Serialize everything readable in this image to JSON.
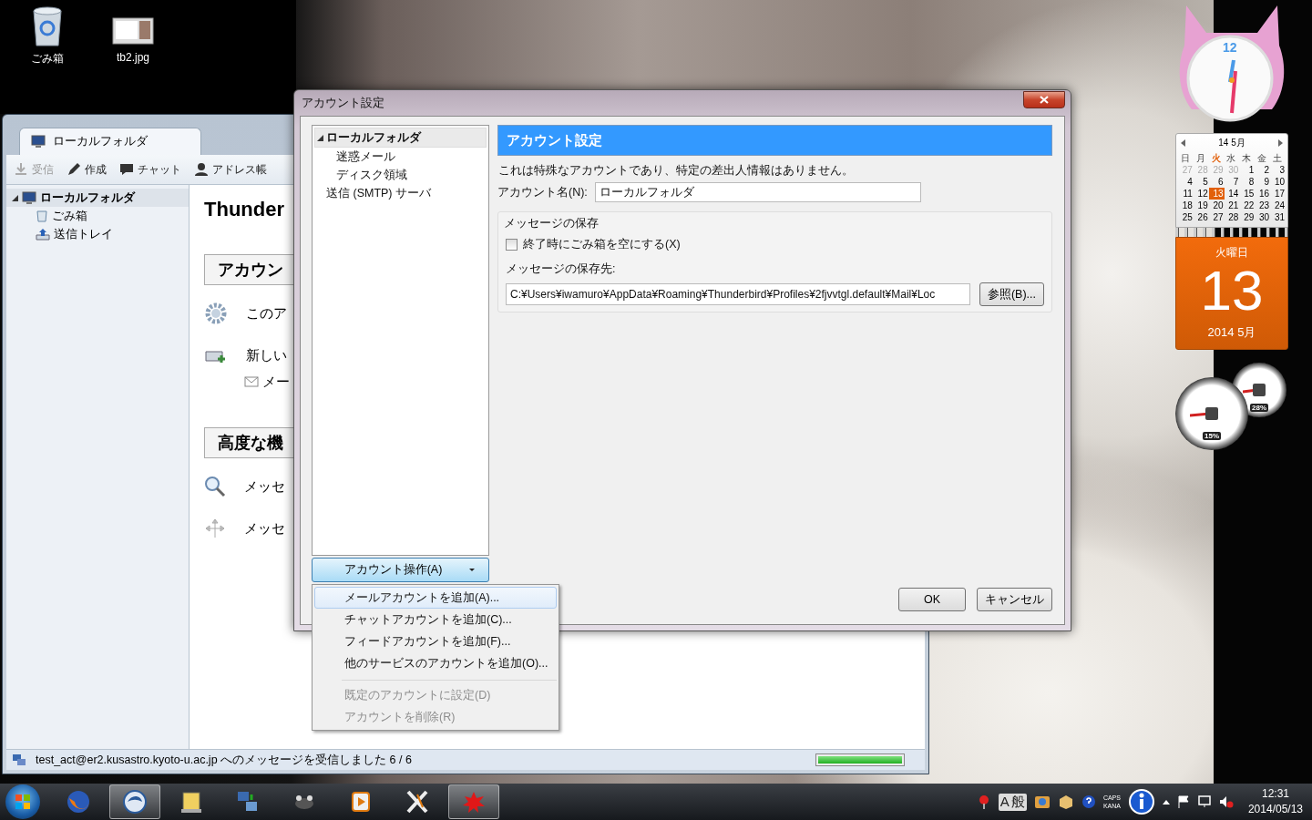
{
  "desktop_icons": [
    {
      "label": "ごみ箱",
      "kind": "trash"
    },
    {
      "label": "tb2.jpg",
      "kind": "image"
    }
  ],
  "mail_window": {
    "tab": "ローカルフォルダ",
    "toolbar": [
      {
        "label": "受信",
        "kind": "get",
        "disabled": true
      },
      {
        "label": "作成",
        "kind": "write",
        "disabled": false
      },
      {
        "label": "チャット",
        "kind": "chat",
        "disabled": false
      },
      {
        "label": "アドレス帳",
        "kind": "contacts",
        "disabled": false
      }
    ],
    "folders": [
      {
        "label": "ローカルフォルダ",
        "kind": "local",
        "selected": true,
        "expanded": true,
        "children": [
          {
            "label": "ごみ箱",
            "kind": "trash",
            "selected": false
          },
          {
            "label": "送信トレイ",
            "kind": "outbox",
            "selected": false
          }
        ]
      }
    ],
    "content": {
      "title": "Thunder",
      "sections": [
        {
          "heading": "アカウン",
          "items": [
            {
              "text": "このア",
              "kind": "gear"
            },
            {
              "text": "新しい",
              "kind": "new-account"
            },
            {
              "text": "メー",
              "kind": "mail"
            }
          ]
        },
        {
          "heading": "高度な機",
          "items": [
            {
              "text": "メッセ",
              "kind": "search"
            },
            {
              "text": "メッセ",
              "kind": "filter"
            }
          ]
        }
      ]
    },
    "status_bar": {
      "text": "test_act@er2.kusastro.kyoto-u.ac.jp へのメッセージを受信しました 6 / 6",
      "level": 1
    }
  },
  "dialog": {
    "title": "アカウント設定",
    "tree": [
      {
        "label": "ローカルフォルダ",
        "expanded": true,
        "selected": true,
        "children": [
          {
            "label": "迷惑メール",
            "selected": false
          },
          {
            "label": "ディスク領域",
            "selected": false
          }
        ]
      },
      {
        "label": "送信 (SMTP) サーバ",
        "selected": false
      }
    ],
    "heading": "アカウント設定",
    "note": "これは特殊なアカウントであり、特定の差出人情報はありません。",
    "account_name": {
      "label": "アカウント名(N):",
      "value": "ローカルフォルダ"
    },
    "storage": {
      "legend": "メッセージの保存",
      "empty_trash": {
        "label": "終了時にごみ箱を空にする(X)",
        "checked": false
      },
      "path_label": "メッセージの保存先:",
      "path": "C:¥Users¥iwamuro¥AppData¥Roaming¥Thunderbird¥Profiles¥2fjvvtgl.default¥Mail¥Loc",
      "browse": "参照(B)..."
    },
    "account_actions": {
      "label": "アカウント操作(A)",
      "expanded": true
    },
    "menu": [
      [
        {
          "label": "メールアカウントを追加(A)...",
          "selected": true,
          "disabled": false
        },
        {
          "label": "チャットアカウントを追加(C)...",
          "selected": false,
          "disabled": false
        },
        {
          "label": "フィードアカウントを追加(F)...",
          "selected": false,
          "disabled": false
        },
        {
          "label": "他のサービスのアカウントを追加(O)...",
          "selected": false,
          "disabled": false
        }
      ],
      [
        {
          "label": "既定のアカウントに設定(D)",
          "selected": false,
          "disabled": true
        },
        {
          "label": "アカウントを削除(R)",
          "selected": false,
          "disabled": true
        }
      ]
    ],
    "buttons": [
      "OK",
      "キャンセル"
    ]
  },
  "gadgets": {
    "clock": {
      "numeral": "12"
    },
    "calendar": {
      "month": "14 5月",
      "weekdays": [
        {
          "label": "日",
          "selected": false
        },
        {
          "label": "月",
          "selected": false
        },
        {
          "label": "火",
          "selected": true
        },
        {
          "label": "水",
          "selected": false
        },
        {
          "label": "木",
          "selected": false
        },
        {
          "label": "金",
          "selected": false
        },
        {
          "label": "土",
          "selected": false
        }
      ],
      "weeks": [
        [
          {
            "day": "27",
            "muted": true,
            "selected": false
          },
          {
            "day": "28",
            "muted": true,
            "selected": false
          },
          {
            "day": "29",
            "muted": true,
            "selected": false
          },
          {
            "day": "30",
            "muted": true,
            "selected": false
          },
          {
            "day": "1",
            "muted": false,
            "selected": false
          },
          {
            "day": "2",
            "muted": false,
            "selected": false
          },
          {
            "day": "3",
            "muted": false,
            "selected": false
          }
        ],
        [
          {
            "day": "4",
            "muted": false,
            "selected": false
          },
          {
            "day": "5",
            "muted": false,
            "selected": false
          },
          {
            "day": "6",
            "muted": false,
            "selected": false
          },
          {
            "day": "7",
            "muted": false,
            "selected": false
          },
          {
            "day": "8",
            "muted": false,
            "selected": false
          },
          {
            "day": "9",
            "muted": false,
            "selected": false
          },
          {
            "day": "10",
            "muted": false,
            "selected": false
          }
        ],
        [
          {
            "day": "11",
            "muted": false,
            "selected": false
          },
          {
            "day": "12",
            "muted": false,
            "selected": false
          },
          {
            "day": "13",
            "muted": false,
            "selected": true
          },
          {
            "day": "14",
            "muted": false,
            "selected": false
          },
          {
            "day": "15",
            "muted": false,
            "selected": false
          },
          {
            "day": "16",
            "muted": false,
            "selected": false
          },
          {
            "day": "17",
            "muted": false,
            "selected": false
          }
        ],
        [
          {
            "day": "18",
            "muted": false,
            "selected": false
          },
          {
            "day": "19",
            "muted": false,
            "selected": false
          },
          {
            "day": "20",
            "muted": false,
            "selected": false
          },
          {
            "day": "21",
            "muted": false,
            "selected": false
          },
          {
            "day": "22",
            "muted": false,
            "selected": false
          },
          {
            "day": "23",
            "muted": false,
            "selected": false
          },
          {
            "day": "24",
            "muted": false,
            "selected": false
          }
        ],
        [
          {
            "day": "25",
            "muted": false,
            "selected": false
          },
          {
            "day": "26",
            "muted": false,
            "selected": false
          },
          {
            "day": "27",
            "muted": false,
            "selected": false
          },
          {
            "day": "28",
            "muted": false,
            "selected": false
          },
          {
            "day": "29",
            "muted": false,
            "selected": false
          },
          {
            "day": "30",
            "muted": false,
            "selected": false
          },
          {
            "day": "31",
            "muted": false,
            "selected": false
          }
        ]
      ],
      "weekday": "火曜日",
      "day": "13",
      "month_year": "2014 5月"
    },
    "meters": [
      {
        "reading": "15%"
      },
      {
        "reading": "28%"
      }
    ]
  },
  "taskbar": {
    "buttons": [
      {
        "highlighted": false
      },
      {
        "highlighted": true
      },
      {
        "highlighted": false
      },
      {
        "highlighted": false
      },
      {
        "highlighted": false
      },
      {
        "highlighted": false
      },
      {
        "highlighted": false
      },
      {
        "highlighted": true
      }
    ],
    "ime": [
      "A",
      "般"
    ],
    "keys": [
      "CAPS",
      "KANA"
    ],
    "time": "12:31",
    "date": "2014/05/13"
  }
}
